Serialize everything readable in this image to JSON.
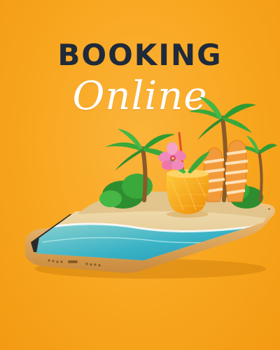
{
  "poster": {
    "title": "BOOKING",
    "subtitle": "Online"
  },
  "colors": {
    "background": "#f8a61f",
    "title": "#1f2a3a",
    "subtitle": "#ffffff",
    "phone_frame": "#e9b36d",
    "sand": "#e8cf9a",
    "sea": "#39b4c4",
    "palm_leaf": "#37a83a",
    "drink": "#f7a40f",
    "flower": "#f07fb3"
  },
  "icons": [
    "palm-tree-icon",
    "surfboard-icon",
    "cocktail-glass-icon",
    "hibiscus-flower-icon",
    "smartphone-icon"
  ]
}
